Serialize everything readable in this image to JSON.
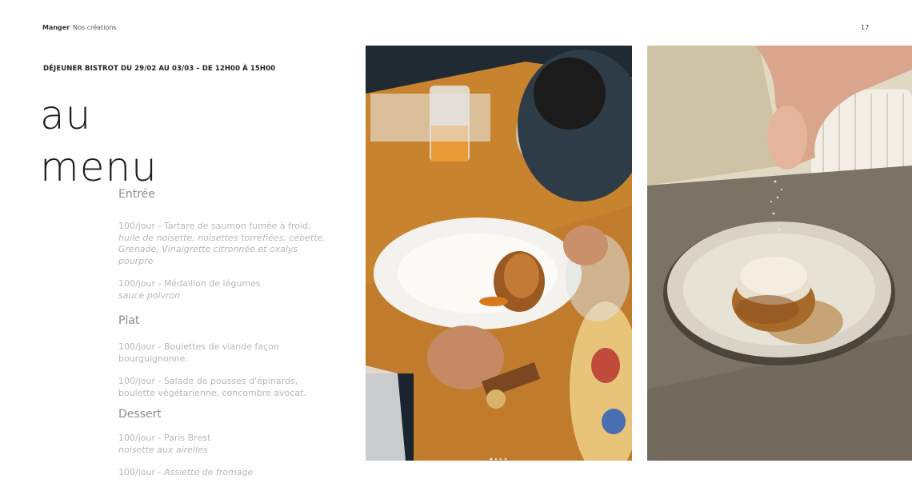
{
  "header": {
    "breadcrumb_section": "Manger",
    "breadcrumb_page": "Nos créations",
    "page_number": "17"
  },
  "event_line": "DÉJEUNER BISTROT DU 29/02 AU 03/03 – DE 12H00 À 15H00",
  "title": {
    "line1": "au",
    "line2": "menu"
  },
  "menu": {
    "entree_heading": "Entrée",
    "entree_items": [
      {
        "plain": "100/jour - Tartare de saumon fumée à froid,",
        "italic": "huile de noisette, noisettes torréfiées, cébette, Grenade, Vinaigrette citronnée et oxalys pourpre"
      },
      {
        "plain": "100/jour  - Médaillon de légumes",
        "italic": "sauce poivron"
      }
    ],
    "plat_heading": "Plat",
    "plat_items": [
      {
        "plain": "100/jour - Boulettes de viande façon bourguignonne."
      },
      {
        "plain": "100/jour - Salade de pousses d'épinards, boulette végétarienne, concombre avocat."
      }
    ],
    "dessert_heading": "Dessert",
    "dessert_items": [
      {
        "plain": "100/jour - Paris Brest",
        "italic": "noisette aux airelles"
      },
      {
        "plain": "100/jour - ",
        "italic_inline": "Assiette de fromage"
      }
    ]
  },
  "photos": {
    "left": "dining-photo",
    "right": "dessert-photo",
    "carousel_dots": 4
  }
}
